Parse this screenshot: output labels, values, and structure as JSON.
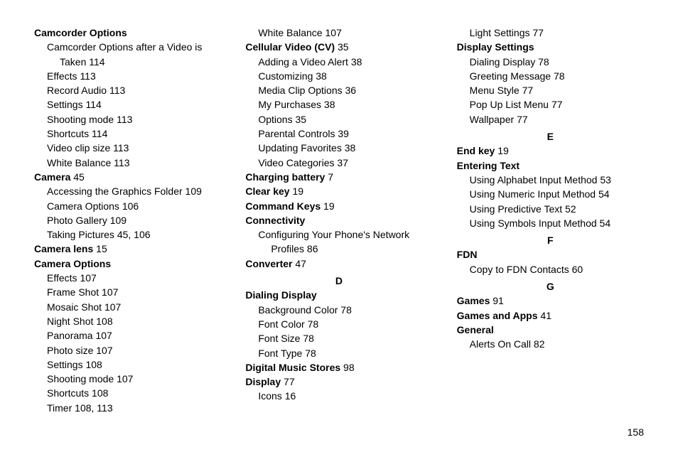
{
  "page_number": "158",
  "flow": [
    {
      "type": "heading",
      "text": "Camcorder Options"
    },
    {
      "type": "sub",
      "text": "Camcorder Options after a Video is"
    },
    {
      "type": "subsub",
      "text": "Taken",
      "pages": "114"
    },
    {
      "type": "sub",
      "text": "Effects",
      "pages": "113"
    },
    {
      "type": "sub",
      "text": "Record Audio",
      "pages": "113"
    },
    {
      "type": "sub",
      "text": "Settings",
      "pages": "114"
    },
    {
      "type": "sub",
      "text": "Shooting mode",
      "pages": "113"
    },
    {
      "type": "sub",
      "text": "Shortcuts",
      "pages": "114"
    },
    {
      "type": "sub",
      "text": "Video clip size",
      "pages": "113"
    },
    {
      "type": "sub",
      "text": "White Balance",
      "pages": "113"
    },
    {
      "type": "heading",
      "text": "Camera",
      "pages": "45"
    },
    {
      "type": "sub",
      "text": "Accessing the Graphics Folder",
      "pages": "109"
    },
    {
      "type": "sub",
      "text": "Camera Options",
      "pages": "106"
    },
    {
      "type": "sub",
      "text": "Photo Gallery",
      "pages": "109"
    },
    {
      "type": "sub",
      "text": "Taking Pictures",
      "pages": "45, 106"
    },
    {
      "type": "heading",
      "text": "Camera lens",
      "pages": "15"
    },
    {
      "type": "heading",
      "text": "Camera Options"
    },
    {
      "type": "sub",
      "text": "Effects",
      "pages": "107"
    },
    {
      "type": "sub",
      "text": "Frame Shot",
      "pages": "107"
    },
    {
      "type": "sub",
      "text": "Mosaic Shot",
      "pages": "107"
    },
    {
      "type": "sub",
      "text": "Night Shot",
      "pages": "108"
    },
    {
      "type": "sub",
      "text": "Panorama",
      "pages": "107"
    },
    {
      "type": "sub",
      "text": "Photo size",
      "pages": "107"
    },
    {
      "type": "sub",
      "text": "Settings",
      "pages": "108"
    },
    {
      "type": "sub",
      "text": "Shooting mode",
      "pages": "107"
    },
    {
      "type": "sub",
      "text": "Shortcuts",
      "pages": "108"
    },
    {
      "type": "sub",
      "text": "Timer",
      "pages": "108, 113"
    },
    {
      "type": "sub",
      "text": "White Balance",
      "pages": "107"
    },
    {
      "type": "heading",
      "text": "Cellular Video (CV)",
      "pages": "35"
    },
    {
      "type": "sub",
      "text": "Adding a Video Alert",
      "pages": "38"
    },
    {
      "type": "sub",
      "text": "Customizing",
      "pages": "38"
    },
    {
      "type": "sub",
      "text": "Media Clip Options",
      "pages": "36"
    },
    {
      "type": "sub",
      "text": "My Purchases",
      "pages": "38"
    },
    {
      "type": "sub",
      "text": "Options",
      "pages": "35"
    },
    {
      "type": "sub",
      "text": "Parental Controls",
      "pages": "39"
    },
    {
      "type": "sub",
      "text": "Updating Favorites",
      "pages": "38"
    },
    {
      "type": "sub",
      "text": "Video Categories",
      "pages": "37"
    },
    {
      "type": "heading",
      "text": "Charging battery",
      "pages": "7"
    },
    {
      "type": "heading",
      "text": "Clear key",
      "pages": "19"
    },
    {
      "type": "heading",
      "text": "Command Keys",
      "pages": "19"
    },
    {
      "type": "heading",
      "text": "Connectivity"
    },
    {
      "type": "sub",
      "text": "Configuring Your Phone's Network"
    },
    {
      "type": "subsub",
      "text": "Profiles",
      "pages": "86"
    },
    {
      "type": "heading",
      "text": "Converter",
      "pages": "47"
    },
    {
      "type": "letter",
      "text": "D"
    },
    {
      "type": "heading",
      "text": "Dialing Display"
    },
    {
      "type": "sub",
      "text": "Background Color",
      "pages": "78"
    },
    {
      "type": "sub",
      "text": "Font Color",
      "pages": "78"
    },
    {
      "type": "sub",
      "text": "Font Size",
      "pages": "78"
    },
    {
      "type": "sub",
      "text": "Font Type",
      "pages": "78"
    },
    {
      "type": "heading",
      "text": "Digital Music Stores",
      "pages": "98"
    },
    {
      "type": "heading",
      "text": "Display",
      "pages": "77"
    },
    {
      "type": "sub",
      "text": "Icons",
      "pages": "16"
    },
    {
      "type": "sub",
      "text": "Light Settings",
      "pages": "77"
    },
    {
      "type": "heading",
      "text": "Display Settings"
    },
    {
      "type": "sub",
      "text": "Dialing Display",
      "pages": "78"
    },
    {
      "type": "sub",
      "text": "Greeting Message",
      "pages": "78"
    },
    {
      "type": "sub",
      "text": "Menu Style",
      "pages": "77"
    },
    {
      "type": "sub",
      "text": "Pop Up List Menu",
      "pages": "77"
    },
    {
      "type": "sub",
      "text": "Wallpaper",
      "pages": "77"
    },
    {
      "type": "letter",
      "text": "E"
    },
    {
      "type": "heading",
      "text": "End key",
      "pages": "19"
    },
    {
      "type": "heading",
      "text": "Entering Text"
    },
    {
      "type": "sub",
      "text": "Using Alphabet Input Method",
      "pages": "53"
    },
    {
      "type": "sub",
      "text": "Using Numeric Input Method",
      "pages": "54"
    },
    {
      "type": "sub",
      "text": "Using Predictive Text",
      "pages": "52"
    },
    {
      "type": "sub",
      "text": "Using Symbols Input Method",
      "pages": "54"
    },
    {
      "type": "letter",
      "text": "F"
    },
    {
      "type": "heading",
      "text": "FDN"
    },
    {
      "type": "sub",
      "text": "Copy to FDN Contacts",
      "pages": "60"
    },
    {
      "type": "letter",
      "text": "G"
    },
    {
      "type": "heading",
      "text": "Games",
      "pages": "91"
    },
    {
      "type": "heading",
      "text": "Games and Apps",
      "pages": "41"
    },
    {
      "type": "heading",
      "text": "General"
    },
    {
      "type": "sub",
      "text": "Alerts On Call",
      "pages": "82"
    }
  ]
}
